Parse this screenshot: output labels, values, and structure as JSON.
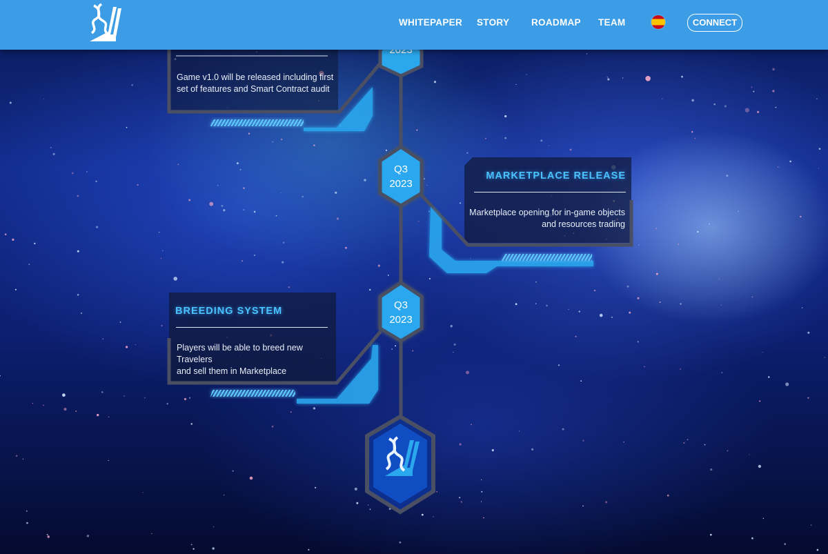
{
  "navbar": {
    "links": [
      "WHITEPAPER",
      "STORY",
      "ROADMAP",
      "TEAM"
    ],
    "language_flag": "spain-flag",
    "connect_label": "CONNECT",
    "background_color": "#3c9de6"
  },
  "roadmap": {
    "partial_card": {
      "quarter_label": "2023",
      "description_lines": [
        "Game v1.0 will be released including first",
        "set of features and Smart Contract audit"
      ]
    },
    "marketplace_card": {
      "quarter": "Q3",
      "year": "2023",
      "title": "MARKETPLACE RELEASE",
      "description_lines": [
        "Marketplace opening for in-game objects",
        "and resources trading"
      ]
    },
    "breeding_card": {
      "quarter": "Q3",
      "year": "2023",
      "title": "BREEDING SYSTEM",
      "description_lines": [
        "Players will be able to breed new Travelers",
        "and sell them in Marketplace"
      ]
    },
    "end_node_icon": "dna-logo-icon"
  },
  "colors": {
    "accent_cyan": "#49c2ff",
    "frame_gray": "#4a4f63",
    "hex_fill": "#2ba7ee"
  }
}
